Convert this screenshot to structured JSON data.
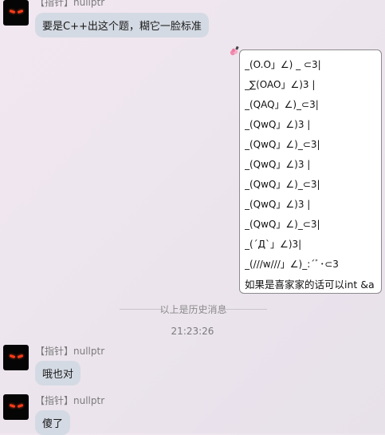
{
  "messages": [
    {
      "sender": "【指针】nullptr",
      "text": "要是C++出这个题，糊它一脸标准"
    },
    {
      "sender": "【指针】nullptr",
      "text": "哦也对"
    },
    {
      "sender": "【指针】nullptr",
      "text": "傻了"
    }
  ],
  "reply_card": {
    "lines": [
      "_(O.O」∠) _ ⊂3|",
      "_∑(OAO」∠)3 |",
      "_(QAQ」∠)_⊂3|",
      "_(QwQ」∠)3 |",
      "_(QwQ」∠)_⊂3|",
      "_(QwQ」∠)3 |",
      "_(QwQ」∠)_⊂3|",
      "_(QwQ」∠)3 |",
      "_(QwQ」∠)_⊂3|",
      "_(´Д`」∠)3|",
      "_(///w///」∠)_:´ﾞ･⊂3",
      "如果是喜家家的话可以int &a"
    ]
  },
  "divider": {
    "label": "以上是历史消息"
  },
  "timestamp": "21:23:26",
  "colors": {
    "bubble": "#d4dae3",
    "background": "#efe6ef",
    "avatar_eye": "#ff3b1a"
  },
  "icons": {
    "avatar": "black-avatar-with-red-eyes",
    "bubble_decoration": "flower-charm-icon"
  }
}
